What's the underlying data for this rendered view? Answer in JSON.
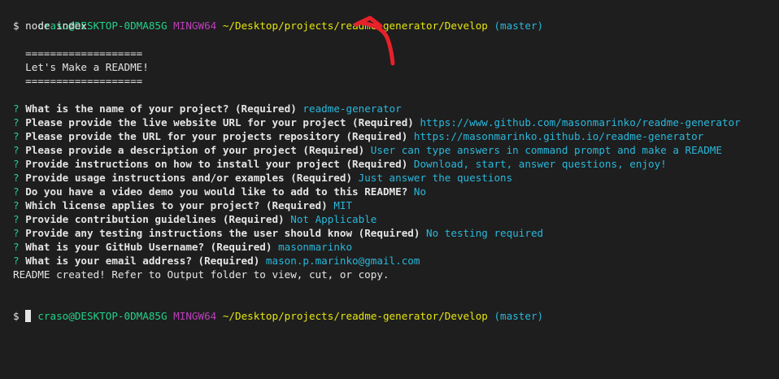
{
  "terminal": {
    "prompt1": {
      "user_host": "craso@DESKTOP-0DMA85G",
      "shell": "MINGW64",
      "path": "~/Desktop/projects/readme-generator/Develop",
      "branch": "(master)"
    },
    "command_line": "$ node index",
    "banner": {
      "rule_top": "===================",
      "title": "Let's Make a README!",
      "rule_bottom": "==================="
    },
    "qa": [
      {
        "mark": "?",
        "question": "What is the name of your project? (Required)",
        "answer": "readme-generator"
      },
      {
        "mark": "?",
        "question": "Please provide the live website URL for your project (Required)",
        "answer": "https://www.github.com/masonmarinko/readme-generator"
      },
      {
        "mark": "?",
        "question": "Please provide the URL for your projects repository (Required)",
        "answer": "https://masonmarinko.github.io/readme-generator"
      },
      {
        "mark": "?",
        "question": "Please provide a description of your project (Required)",
        "answer": "User can type answers in command prompt and make a README"
      },
      {
        "mark": "?",
        "question": "Provide instructions on how to install your project (Required)",
        "answer": "Download, start, answer questions, enjoy!"
      },
      {
        "mark": "?",
        "question": "Provide usage instructions and/or examples (Required)",
        "answer": "Just answer the questions"
      },
      {
        "mark": "?",
        "question": "Do you have a video demo you would like to add to this README?",
        "answer": "No"
      },
      {
        "mark": "?",
        "question": "Which license applies to your project? (Required)",
        "answer": "MIT"
      },
      {
        "mark": "?",
        "question": "Provide contribution guidelines (Required)",
        "answer": "Not Applicable"
      },
      {
        "mark": "?",
        "question": "Provide any testing instructions the user should know (Required)",
        "answer": "No testing required"
      },
      {
        "mark": "?",
        "question": "What is your GitHub Username? (Required)",
        "answer": "masonmarinko"
      },
      {
        "mark": "?",
        "question": "What is your email address? (Required)",
        "answer": "mason.p.marinko@gmail.com"
      }
    ],
    "result_message": "README created! Refer to Output folder to view, cut, or copy.",
    "prompt2": {
      "user_host": "craso@DESKTOP-0DMA85G",
      "shell": "MINGW64",
      "path": "~/Desktop/projects/readme-generator/Develop",
      "branch": "(master)"
    },
    "final_prompt": "$"
  },
  "colors": {
    "background": "#1e1e1e",
    "user_host": "#23d18b",
    "shell": "#bc3fbc",
    "path": "#e5e510",
    "branch": "#29b8db",
    "answer": "#29b8db",
    "annotation_arrow": "#e8202a"
  },
  "icons": {
    "annotation": "red-hand-drawn-arrow-icon",
    "cursor": "block-cursor-icon"
  }
}
